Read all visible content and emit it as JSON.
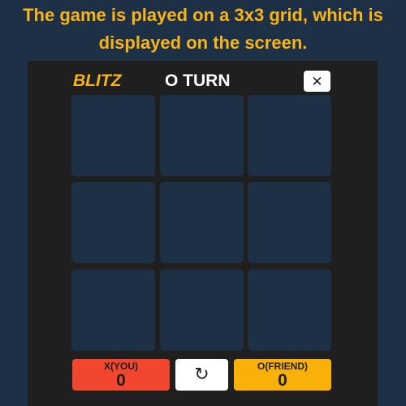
{
  "header": {
    "line1": "The game is played on a 3x3 grid, which is",
    "line2": "displayed on the screen."
  },
  "game": {
    "mode_label": "BLITZ",
    "turn_label": "O TURN",
    "close_glyph": "✕",
    "board": [
      "",
      "",
      "",
      "",
      "",
      "",
      "",
      "",
      ""
    ],
    "restart_glyph": "↻"
  },
  "scores": {
    "x": {
      "name": "X(YOU)",
      "value": "0"
    },
    "o": {
      "name": "O(FRIEND)",
      "value": "0"
    }
  },
  "colors": {
    "background": "#1e3046",
    "panel": "#1f1f1f",
    "accent": "#f5b31c",
    "x_score": "#f2462e",
    "o_score": "#f9b10a"
  }
}
